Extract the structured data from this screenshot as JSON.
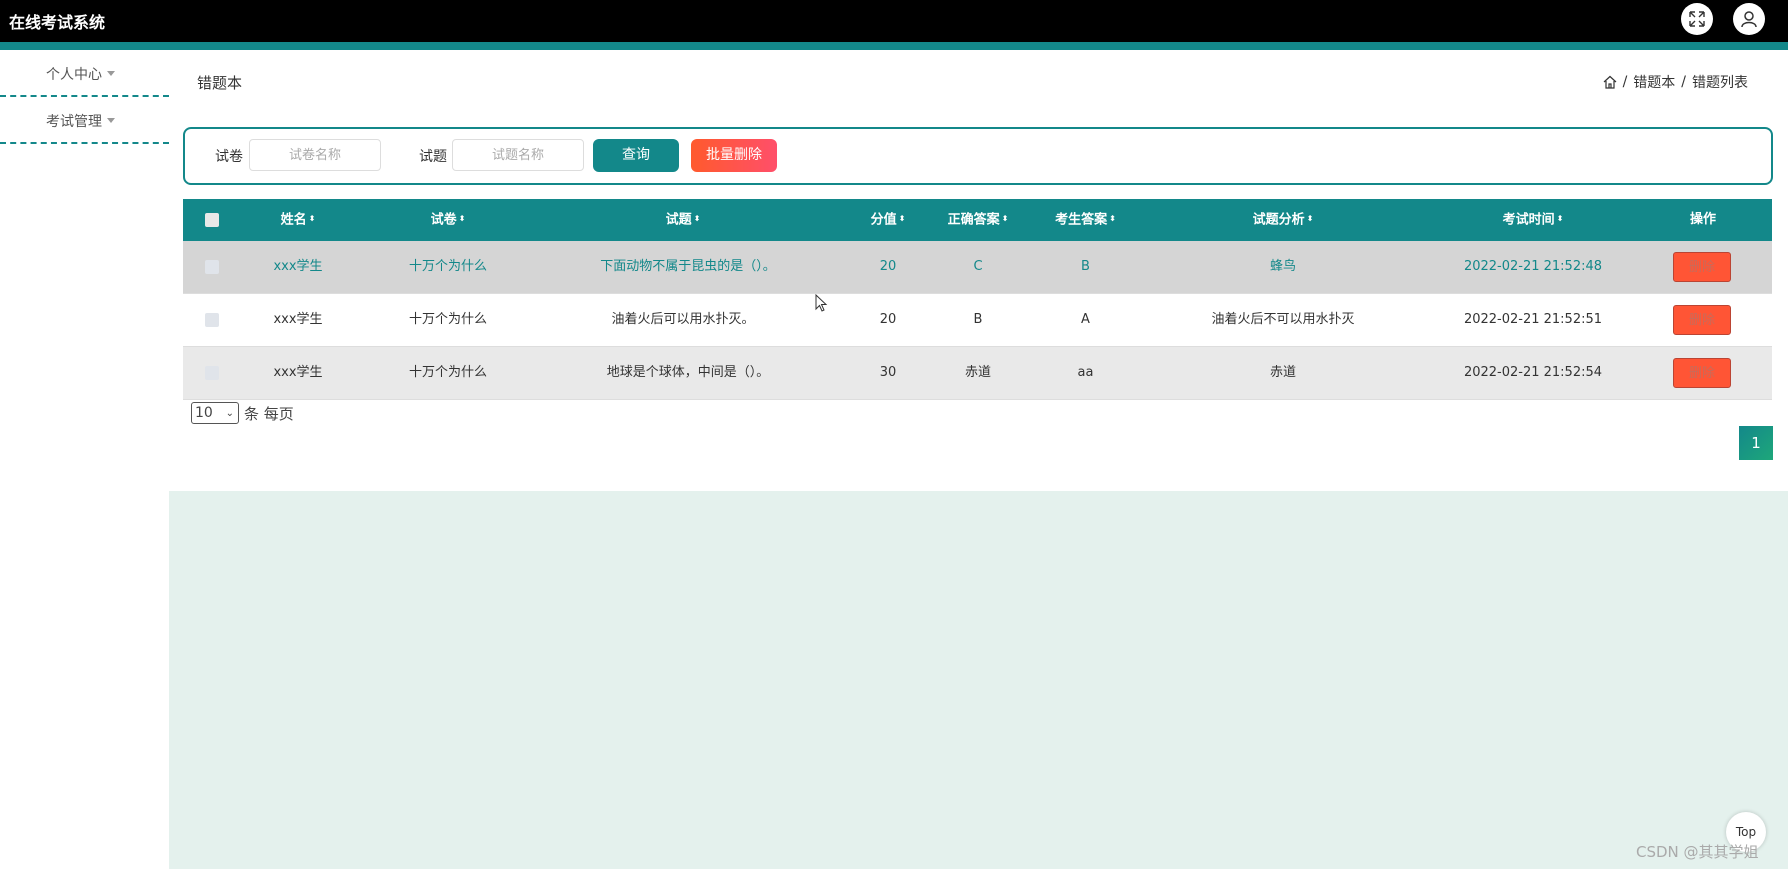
{
  "app": {
    "title": "在线考试系统"
  },
  "sidebar": {
    "items": [
      {
        "label": "个人中心"
      },
      {
        "label": "考试管理"
      }
    ]
  },
  "page": {
    "title": "错题本"
  },
  "breadcrumb": {
    "items": [
      "错题本",
      "错题列表"
    ],
    "separator": "/"
  },
  "search": {
    "paper_label": "试卷",
    "paper_placeholder": "试卷名称",
    "question_label": "试题",
    "question_placeholder": "试题名称",
    "query_label": "查询",
    "bulk_delete_label": "批量删除"
  },
  "table": {
    "columns": [
      "姓名",
      "试卷",
      "试题",
      "分值",
      "正确答案",
      "考生答案",
      "试题分析",
      "考试时间",
      "操作"
    ],
    "rows": [
      {
        "name": "xxx学生",
        "paper": "十万个为什么",
        "question": "下面动物不属于昆虫的是（）。",
        "score": "20",
        "correct": "C",
        "answer": "B",
        "analysis": "蜂鸟",
        "time": "2022-02-21 21:52:48",
        "action": "删除"
      },
      {
        "name": "xxx学生",
        "paper": "十万个为什么",
        "question": "油着火后可以用水扑灭。",
        "score": "20",
        "correct": "B",
        "answer": "A",
        "analysis": "油着火后不可以用水扑灭",
        "time": "2022-02-21 21:52:51",
        "action": "删除"
      },
      {
        "name": "xxx学生",
        "paper": "十万个为什么",
        "question": "地球是个球体，中间是（）。",
        "score": "30",
        "correct": "赤道",
        "answer": "aa",
        "analysis": "赤道",
        "time": "2022-02-21 21:52:54",
        "action": "删除"
      }
    ]
  },
  "pagination": {
    "page_size": "10",
    "per_page_text": "条 每页",
    "current_page": "1"
  },
  "top_button": {
    "label": "Top"
  },
  "watermark": {
    "text": "CSDN @其其学姐"
  },
  "colors": {
    "primary": "#13888a",
    "danger": "#ff5535",
    "bottom_bg": "#e4f1ed"
  }
}
